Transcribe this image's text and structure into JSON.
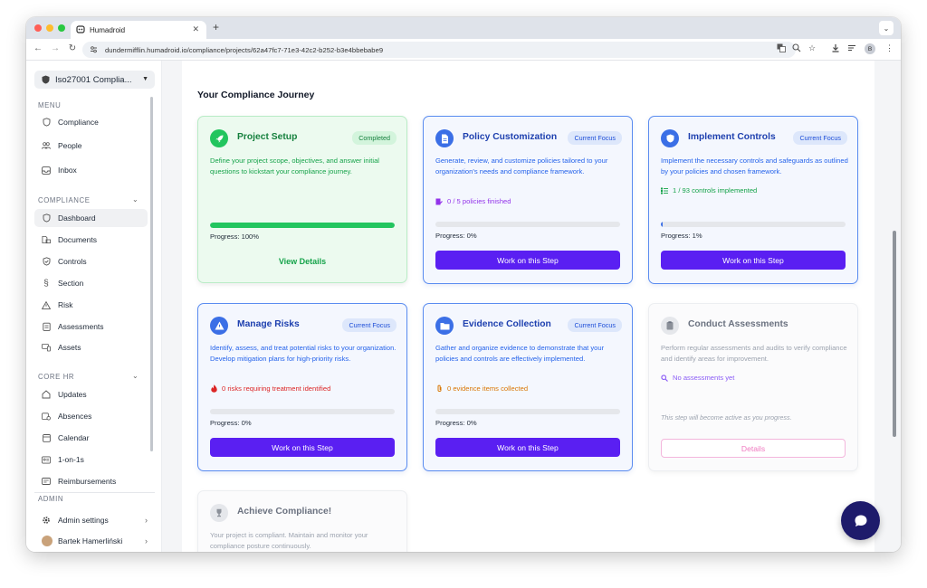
{
  "browser": {
    "tab_title": "Humadroid",
    "url": "dundermifflin.humadroid.io/compliance/projects/62a47fc7-71e3-42c2-b252-b3e4bbebabe9",
    "profile_initial": "B",
    "colors": {
      "close": "#ff5f57",
      "minimize": "#febc2e",
      "maximize": "#28c840"
    }
  },
  "sidebar": {
    "project_selector": "Iso27001 Complia...",
    "menu_heading": "MENU",
    "menu_items": [
      {
        "label": "Compliance",
        "icon": "shield-icon"
      },
      {
        "label": "People",
        "icon": "people-icon"
      },
      {
        "label": "Inbox",
        "icon": "inbox-icon"
      }
    ],
    "compliance_heading": "COMPLIANCE",
    "compliance_items": [
      {
        "label": "Dashboard",
        "icon": "shield-icon",
        "active": true
      },
      {
        "label": "Documents",
        "icon": "documents-icon"
      },
      {
        "label": "Controls",
        "icon": "shield-check-icon"
      },
      {
        "label": "Section",
        "icon": "section-icon"
      },
      {
        "label": "Risk",
        "icon": "warning-icon"
      },
      {
        "label": "Assessments",
        "icon": "assessment-icon"
      },
      {
        "label": "Assets",
        "icon": "assets-icon"
      }
    ],
    "corehr_heading": "CORE HR",
    "corehr_items": [
      {
        "label": "Updates",
        "icon": "home-icon"
      },
      {
        "label": "Absences",
        "icon": "absences-icon"
      },
      {
        "label": "Calendar",
        "icon": "calendar-icon"
      },
      {
        "label": "1-on-1s",
        "icon": "meeting-icon"
      },
      {
        "label": "Reimbursements",
        "icon": "receipt-icon"
      }
    ],
    "admin_heading": "ADMIN",
    "admin_settings": "Admin settings",
    "user_name": "Bartek Hamerliński"
  },
  "main": {
    "section_title": "Your Compliance Journey",
    "cards": [
      {
        "title": "Project Setup",
        "badge": "Completed",
        "description": "Define your project scope, objectives, and answer initial questions to kickstart your compliance journey.",
        "progress_text": "Progress: 100%",
        "progress": 100,
        "action": "View Details",
        "icon": "rocket-icon"
      },
      {
        "title": "Policy Customization",
        "badge": "Current Focus",
        "description": "Generate, review, and customize policies tailored to your organization's needs and compliance framework.",
        "stat": "0 / 5 policies finished",
        "progress_text": "Progress: 0%",
        "progress": 0,
        "action": "Work on this Step",
        "icon": "document-icon"
      },
      {
        "title": "Implement Controls",
        "badge": "Current Focus",
        "description": "Implement the necessary controls and safeguards as outlined by your policies and chosen framework.",
        "stat": "1 / 93 controls implemented",
        "progress_text": "Progress: 1%",
        "progress": 1,
        "action": "Work on this Step",
        "icon": "shield-icon"
      },
      {
        "title": "Manage Risks",
        "badge": "Current Focus",
        "description": "Identify, assess, and treat potential risks to your organization. Develop mitigation plans for high-priority risks.",
        "stat": "0 risks requiring treatment identified",
        "progress_text": "Progress: 0%",
        "progress": 0,
        "action": "Work on this Step",
        "icon": "warning-icon"
      },
      {
        "title": "Evidence Collection",
        "badge": "Current Focus",
        "description": "Gather and organize evidence to demonstrate that your policies and controls are effectively implemented.",
        "stat": "0 evidence items collected",
        "progress_text": "Progress: 0%",
        "progress": 0,
        "action": "Work on this Step",
        "icon": "folder-icon"
      },
      {
        "title": "Conduct Assessments",
        "description": "Perform regular assessments and audits to verify compliance and identify areas for improvement.",
        "stat": "No assessments yet",
        "note": "This step will become active as you progress.",
        "action": "Details",
        "icon": "clipboard-icon"
      },
      {
        "title": "Achieve Compliance!",
        "description": "Your project is compliant. Maintain and monitor your compliance posture continuously.",
        "icon": "trophy-icon"
      }
    ]
  },
  "colors": {
    "primary_button": "#5a1ff2",
    "completed_green": "#22c55e",
    "focus_blue": "#3b6fe6",
    "details_pink": "#f07ac0"
  }
}
